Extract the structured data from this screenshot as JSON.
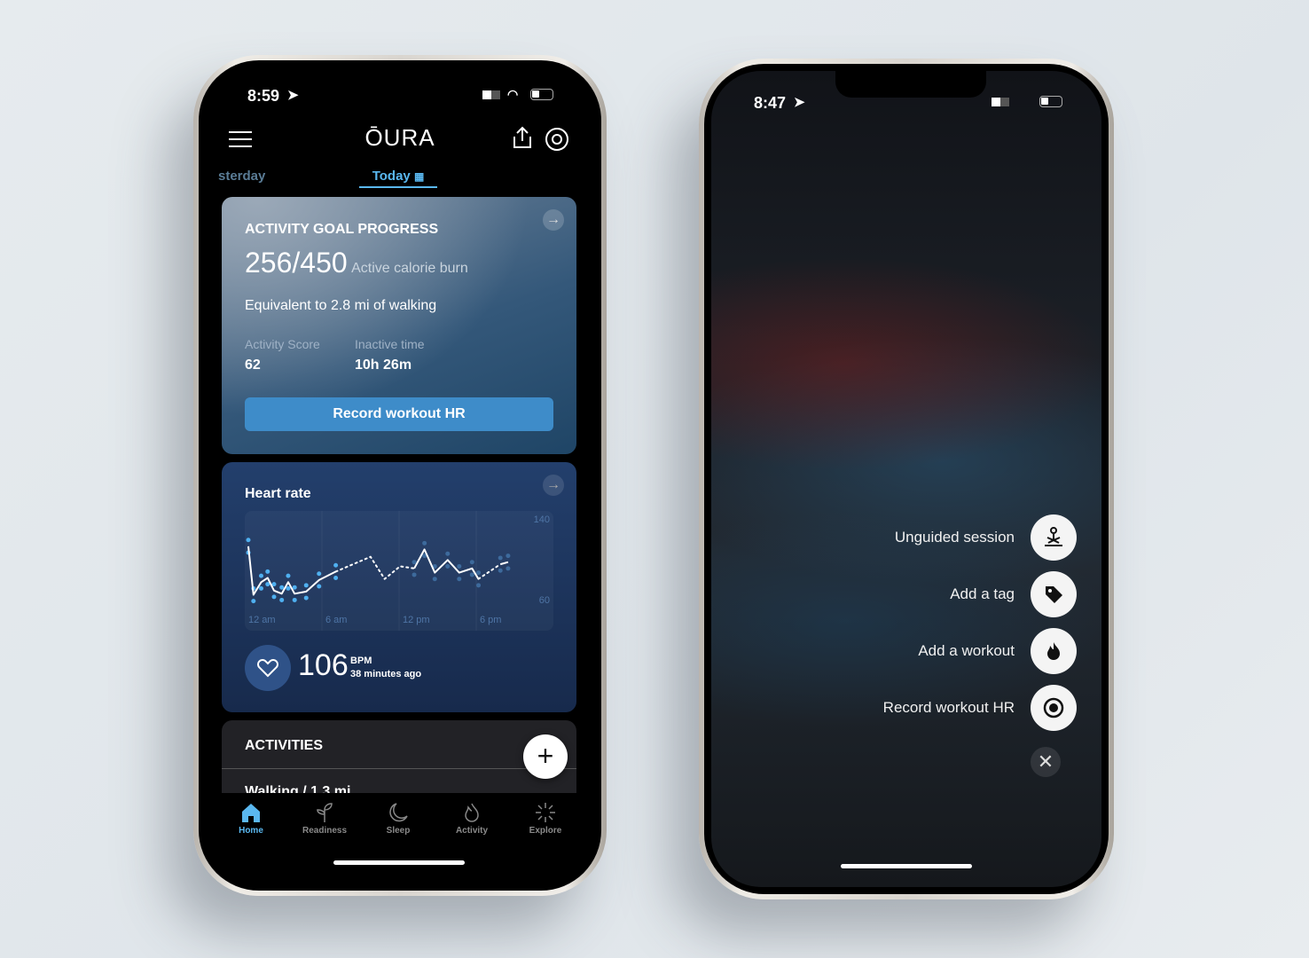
{
  "left_phone": {
    "status": {
      "time": "8:59"
    },
    "header": {
      "logo": "ŌURA",
      "menu_icon": "hamburger-icon",
      "share_icon": "share-icon",
      "settings_icon": "ring-icon"
    },
    "date_tabs": [
      {
        "label": "sterday"
      },
      {
        "label": "Today",
        "active": true
      }
    ],
    "activity_card": {
      "title": "ACTIVITY GOAL PROGRESS",
      "progress": "256/450",
      "progress_value": 256,
      "goal": 450,
      "progress_unit": "Active calorie burn",
      "equivalent": "Equivalent to 2.8 mi of walking",
      "score_label": "Activity Score",
      "score": "62",
      "inactive_label": "Inactive time",
      "inactive": "10h 26m",
      "button": "Record workout HR"
    },
    "heart_card": {
      "title": "Heart rate",
      "bpm": "106",
      "bpm_unit": "BPM",
      "ago": "38 minutes ago",
      "chart_data": {
        "type": "line",
        "x_ticks": [
          "12 am",
          "6 am",
          "12 pm",
          "6 pm"
        ],
        "y_ticks": [
          "140",
          "60"
        ],
        "ylim": [
          60,
          140
        ],
        "xlim_hours": [
          0,
          24
        ],
        "segments": [
          {
            "style": "solid",
            "points": [
              [
                0,
                114
              ],
              [
                0.4,
                68
              ],
              [
                1,
                80
              ],
              [
                1.5,
                84
              ],
              [
                2,
                72
              ],
              [
                2.6,
                69
              ],
              [
                3.1,
                80
              ],
              [
                3.6,
                69
              ],
              [
                4.5,
                71
              ],
              [
                5.5,
                82
              ],
              [
                6.8,
                90
              ]
            ]
          },
          {
            "style": "dotted",
            "points": [
              [
                6.8,
                90
              ],
              [
                9.5,
                104
              ],
              [
                10.6,
                83
              ],
              [
                11.8,
                95
              ],
              [
                12.9,
                93
              ]
            ]
          },
          {
            "style": "solid",
            "points": [
              [
                12.9,
                93
              ],
              [
                13.7,
                111
              ],
              [
                14.5,
                89
              ],
              [
                15.5,
                101
              ],
              [
                16.4,
                89
              ],
              [
                17.4,
                93
              ],
              [
                17.9,
                83
              ]
            ]
          },
          {
            "style": "dotted",
            "points": [
              [
                17.9,
                83
              ],
              [
                19.6,
                97
              ]
            ]
          },
          {
            "style": "solid",
            "points": [
              [
                19.6,
                97
              ],
              [
                20.2,
                99
              ]
            ]
          }
        ]
      }
    },
    "activities": {
      "title": "ACTIVITIES",
      "first_item": "Walking / 1.3 mi"
    },
    "tabs": [
      {
        "label": "Home",
        "icon": "home-icon",
        "active": true
      },
      {
        "label": "Readiness",
        "icon": "sprout-icon"
      },
      {
        "label": "Sleep",
        "icon": "moon-icon"
      },
      {
        "label": "Activity",
        "icon": "flame-icon"
      },
      {
        "label": "Explore",
        "icon": "sparkle-icon"
      }
    ],
    "accent": "#5ab8f0"
  },
  "right_phone": {
    "status": {
      "time": "8:47"
    },
    "menu": [
      {
        "label": "Unguided session",
        "icon": "meditation-icon"
      },
      {
        "label": "Add a tag",
        "icon": "tag-icon"
      },
      {
        "label": "Add a workout",
        "icon": "flame-icon"
      },
      {
        "label": "Record workout HR",
        "icon": "record-icon"
      }
    ],
    "close_icon": "close-icon"
  }
}
